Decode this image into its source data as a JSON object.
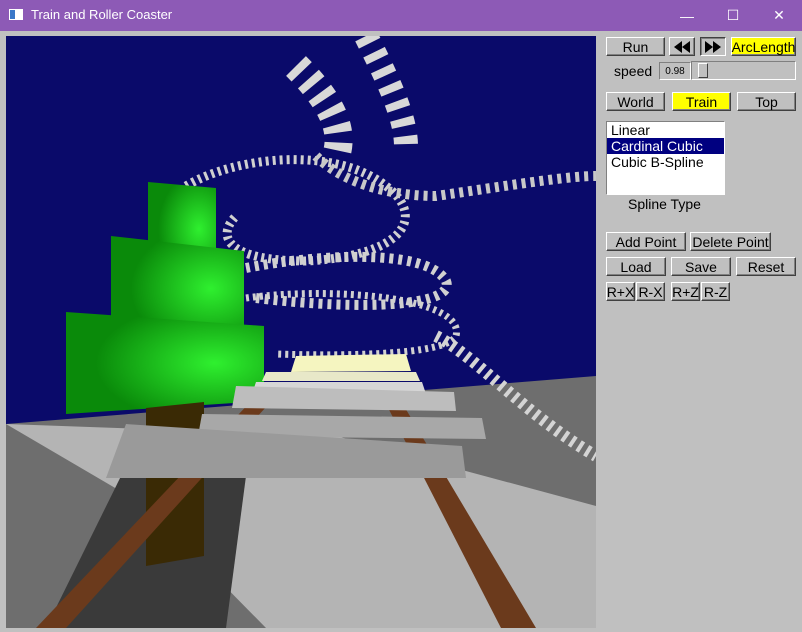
{
  "window": {
    "title": "Train and Roller Coaster",
    "minimize_glyph": "—",
    "maximize_glyph": "☐",
    "close_glyph": "✕"
  },
  "controls": {
    "run_label": "Run",
    "rewind_icon": "rewind-icon",
    "fastforward_icon": "fast-forward-icon",
    "arclength_label": "ArcLength",
    "speed_label": "speed",
    "speed_value": "0.98",
    "speed_fraction": 0.05
  },
  "view": {
    "world_label": "World",
    "train_label": "Train",
    "top_label": "Top",
    "selected": "Train"
  },
  "spline": {
    "options": [
      "Linear",
      "Cardinal Cubic",
      "Cubic B-Spline"
    ],
    "selected": "Cardinal Cubic",
    "type_label": "Spline Type"
  },
  "points": {
    "add_label": "Add Point",
    "delete_label": "Delete Point",
    "load_label": "Load",
    "save_label": "Save",
    "reset_label": "Reset",
    "rxp_label": "R+X",
    "rxm_label": "R-X",
    "rzp_label": "R+Z",
    "rzm_label": "R-Z"
  },
  "colors": {
    "titlebar": "#8d5ab6",
    "sky": "#0a0a6a",
    "highlight": "#ffff00",
    "list_selection": "#000080",
    "tree": "#1fc21f",
    "trunk": "#3a2a05",
    "rail": "#6b3a1c",
    "tie": "#b8b8b8"
  }
}
